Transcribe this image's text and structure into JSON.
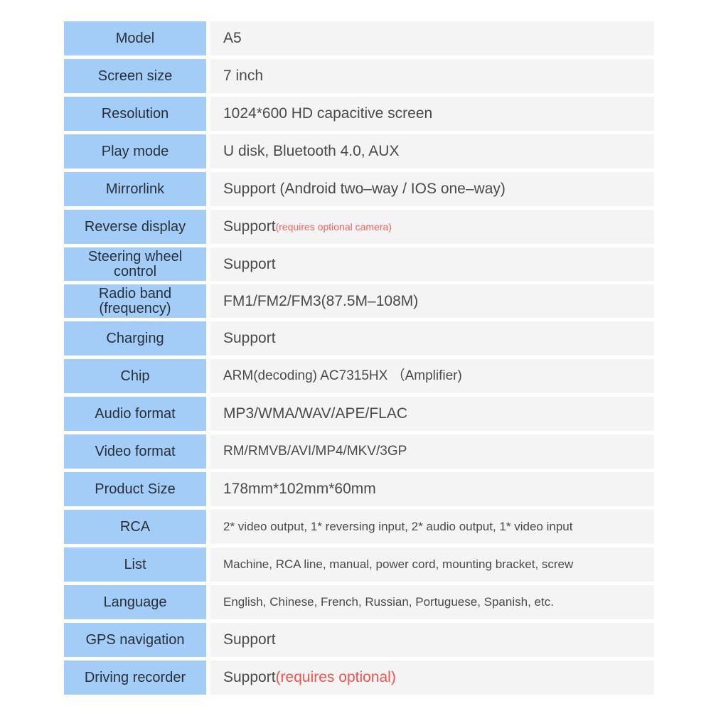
{
  "table": {
    "label_color": "#a3cdf7",
    "value_bg_color": "#f4f4f4",
    "label_text_color": "#26303c",
    "value_text_color": "#4a4a4a",
    "accent_red": "#f4534d",
    "rows": [
      {
        "label": "Model",
        "value": "A5"
      },
      {
        "label": "Screen size",
        "value": "7 inch"
      },
      {
        "label": "Resolution",
        "value": "1024*600 HD capacitive screen"
      },
      {
        "label": "Play mode",
        "value": "U disk, Bluetooth 4.0, AUX"
      },
      {
        "label": "Mirrorlink",
        "value": "Support (Android two–way / IOS one–way)"
      },
      {
        "label": "Reverse display",
        "value": "Support",
        "note": "(requires optional camera)"
      },
      {
        "label": "Steering wheel\ncontrol",
        "value": "Support"
      },
      {
        "label": "Radio band\n(frequency)",
        "value": "FM1/FM2/FM3(87.5M–108M)"
      },
      {
        "label": "Charging",
        "value": "Support"
      },
      {
        "label": "Chip",
        "value": "ARM(decoding)   AC7315HX （Amplifier)"
      },
      {
        "label": "Audio format",
        "value": "MP3/WMA/WAV/APE/FLAC"
      },
      {
        "label": "Video format",
        "value": "RM/RMVB/AVI/MP4/MKV/3GP"
      },
      {
        "label": "Product Size",
        "value": "178mm*102mm*60mm"
      },
      {
        "label": "RCA",
        "value": "2* video output, 1* reversing input, 2* audio output, 1* video input"
      },
      {
        "label": "List",
        "value": "Machine, RCA line, manual, power cord, mounting bracket, screw"
      },
      {
        "label": "Language",
        "value": "English, Chinese, French, Russian, Portuguese, Spanish, etc."
      },
      {
        "label": "GPS navigation",
        "value": "Support"
      },
      {
        "label": "Driving recorder",
        "value": "Support",
        "note": "(requires optional)"
      }
    ]
  }
}
